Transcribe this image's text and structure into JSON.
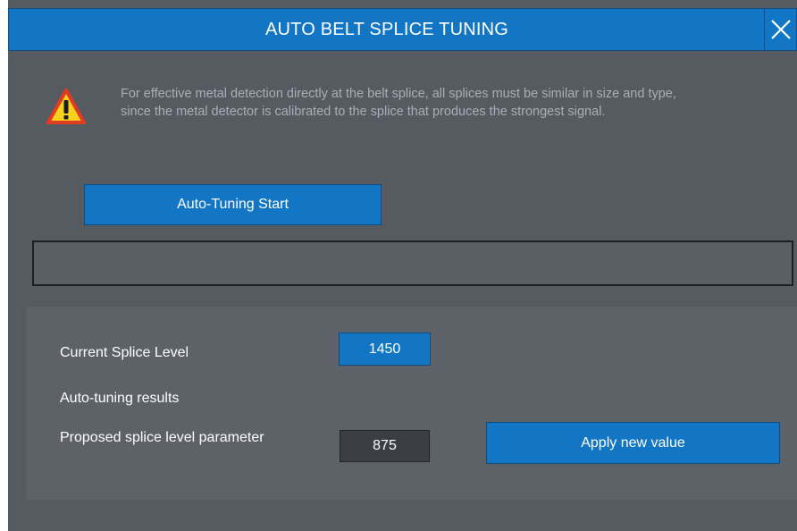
{
  "window": {
    "title": "AUTO BELT SPLICE TUNING",
    "close_icon": "close-icon"
  },
  "warning": {
    "icon": "warning-icon",
    "text": "For effective metal detection directly at the belt splice, all splices must be similar in size and type, since the metal detector is calibrated to the splice that produces the strongest signal."
  },
  "actions": {
    "auto_tune_label": "Auto-Tuning Start",
    "apply_label": "Apply new value"
  },
  "status": {
    "text": ""
  },
  "results": {
    "current_label": "Current Splice Level",
    "current_value": "1450",
    "results_label": "Auto-tuning results",
    "proposed_label": "Proposed splice level parameter",
    "proposed_value": "875"
  },
  "colors": {
    "accent": "#1276c4",
    "background": "#565b62",
    "panel": "#5d6168",
    "warning_yellow": "#f7d21c",
    "warning_border": "#e23b22"
  }
}
